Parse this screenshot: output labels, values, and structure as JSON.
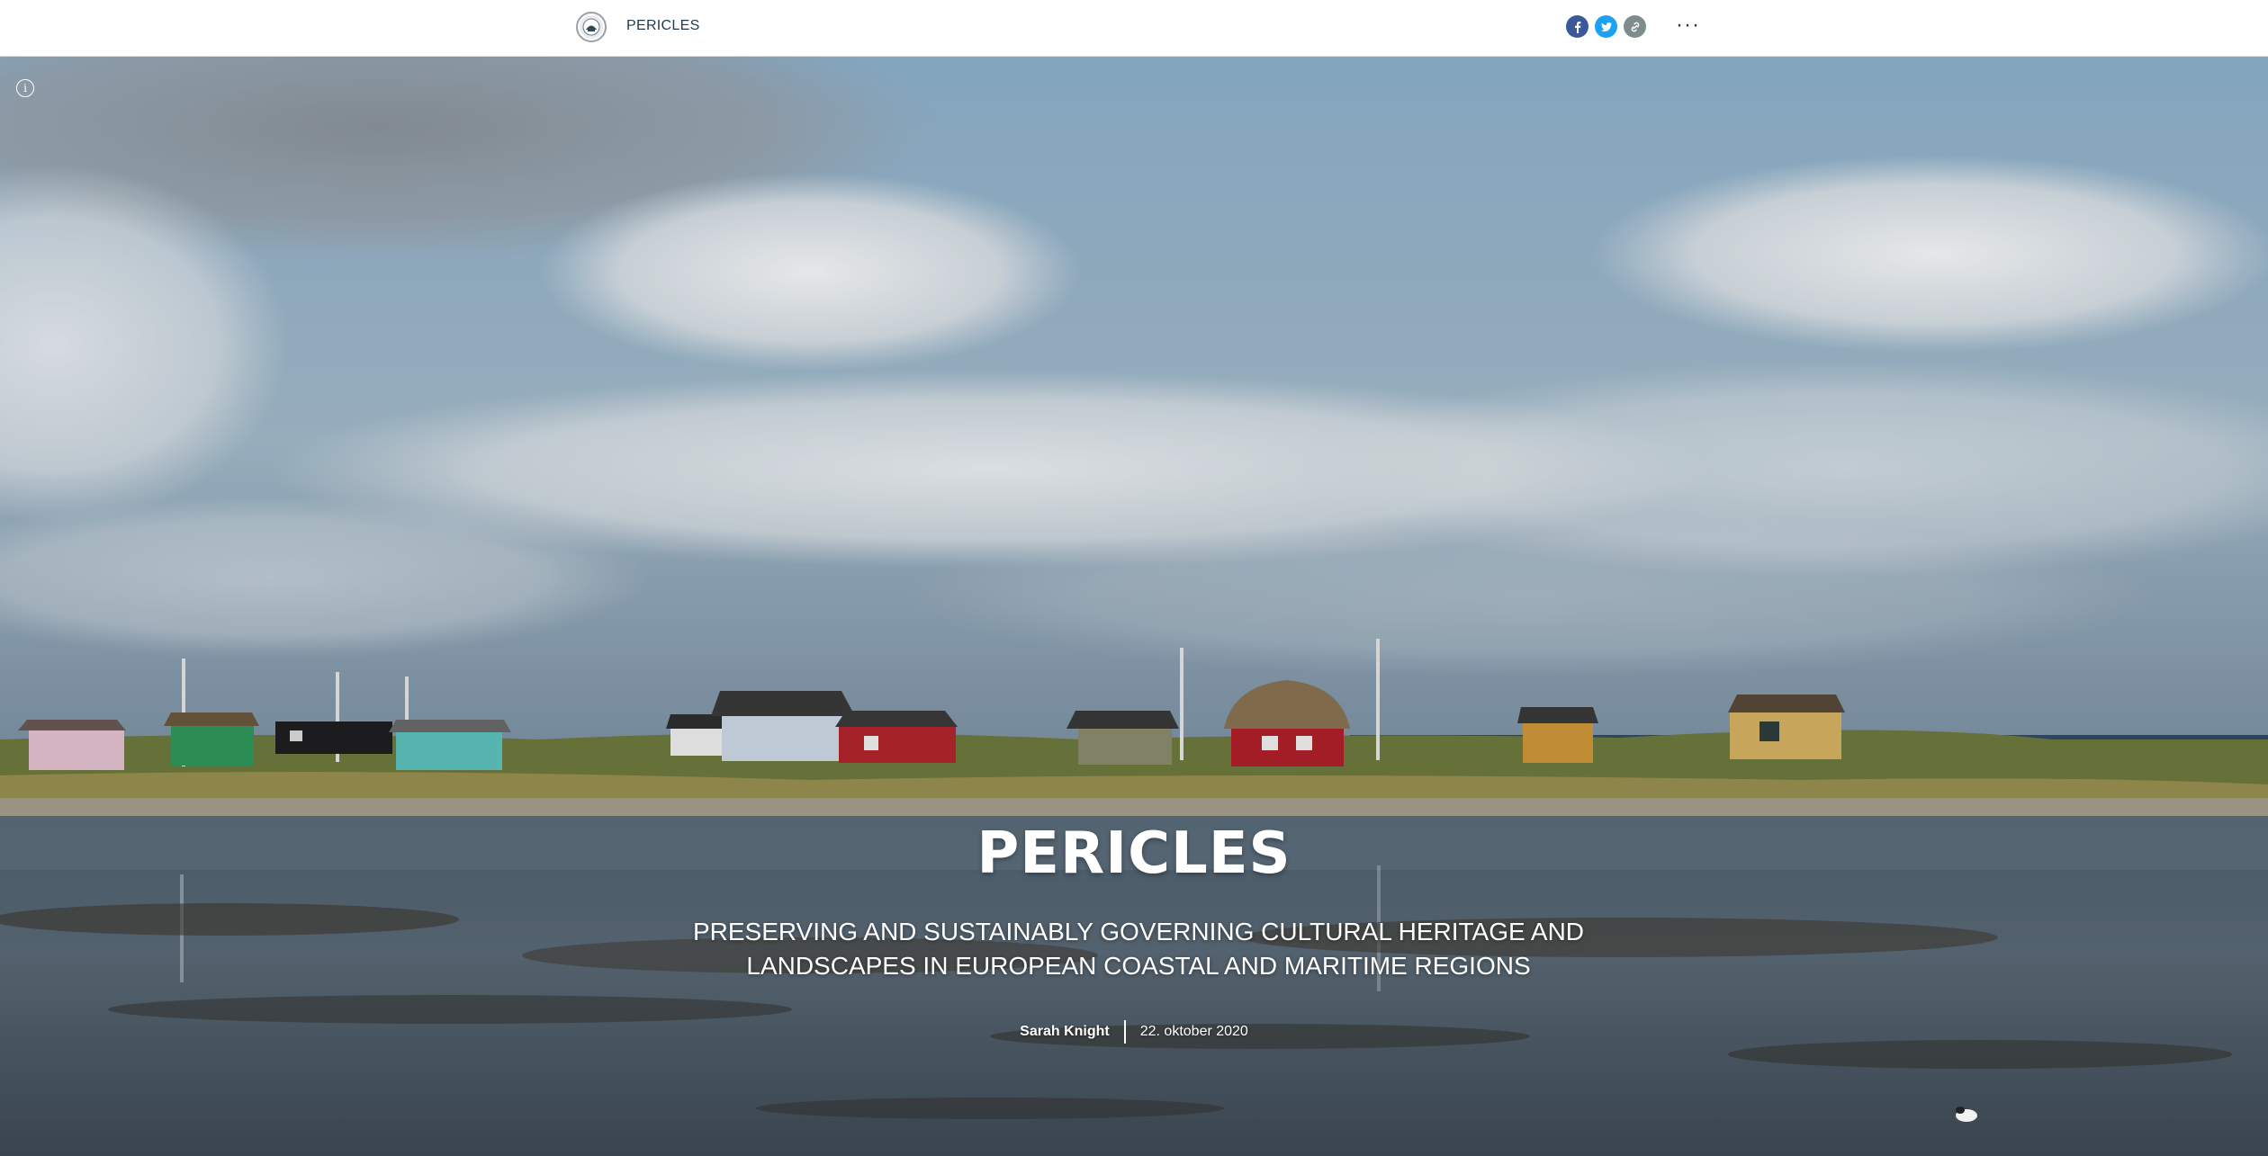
{
  "header": {
    "brand": "PERICLES",
    "share": {
      "facebook_icon": "facebook-icon",
      "twitter_icon": "twitter-icon",
      "link_icon": "link-icon"
    },
    "more_label": "···"
  },
  "hero": {
    "info_label": "i",
    "title": "PERICLES",
    "subtitle": "PRESERVING AND SUSTAINABLY GOVERNING CULTURAL HERITAGE AND LANDSCAPES IN EUROPEAN COASTAL AND MARITIME REGIONS",
    "author": "Sarah Knight",
    "date": "22. oktober 2020"
  },
  "colors": {
    "facebook": "#3b5998",
    "twitter": "#1da1f2",
    "link": "#7f8c8d",
    "brand_text": "#1d3b4f"
  }
}
